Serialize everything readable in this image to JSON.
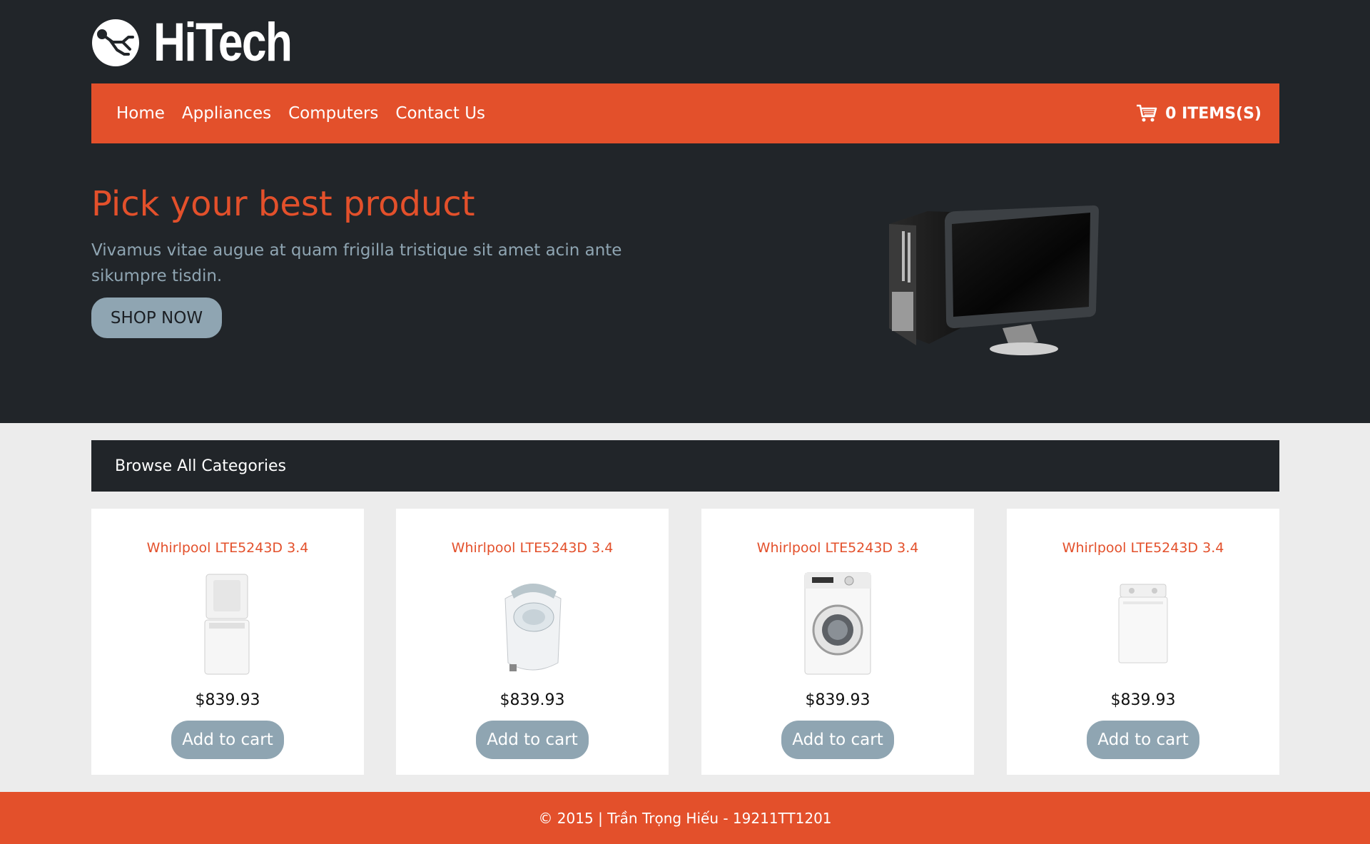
{
  "brand": {
    "name": "HiTech",
    "accent": "#e3502b",
    "dark": "#212529",
    "muted": "#8fa5b2"
  },
  "nav": {
    "items": [
      {
        "label": "Home"
      },
      {
        "label": "Appliances"
      },
      {
        "label": "Computers"
      },
      {
        "label": "Contact Us"
      }
    ],
    "cart_icon": "cart-icon",
    "cart_label": "0 ITEMS(S)"
  },
  "hero": {
    "title": "Pick your best product",
    "text": "Vivamus vitae augue at quam frigilla tristique sit amet acin ante sikumpre tisdin.",
    "button": "SHOP NOW",
    "image": "desktop-computer-and-monitor"
  },
  "categories": {
    "title": "Browse All Categories"
  },
  "products": [
    {
      "name": "Whirlpool LTE5243D 3.4",
      "price": "$839.93",
      "button": "Add to cart",
      "image": "stacked-washer-dryer"
    },
    {
      "name": "Whirlpool LTE5243D 3.4",
      "price": "$839.93",
      "button": "Add to cart",
      "image": "portable-top-load-washer"
    },
    {
      "name": "Whirlpool LTE5243D 3.4",
      "price": "$839.93",
      "button": "Add to cart",
      "image": "front-load-washer"
    },
    {
      "name": "Whirlpool LTE5243D 3.4",
      "price": "$839.93",
      "button": "Add to cart",
      "image": "top-load-washer"
    }
  ],
  "footer": {
    "text": "© 2015 | Trần Trọng Hiếu - 19211TT1201"
  }
}
